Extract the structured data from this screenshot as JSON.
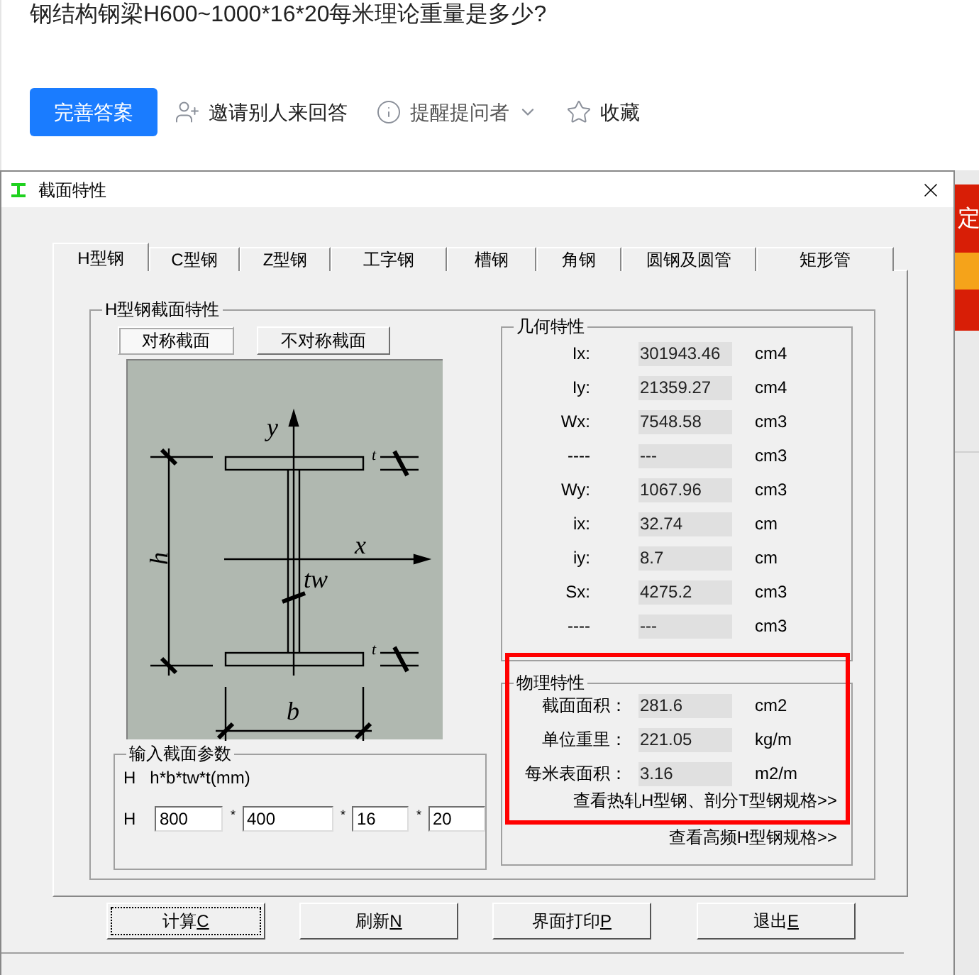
{
  "question": {
    "title": "钢结构钢梁H600~1000*16*20每米理论重量是多少?"
  },
  "actions": [
    {
      "kind": "primary",
      "label": "完善答案"
    },
    {
      "kind": "invite",
      "label": "邀请别人来回答"
    },
    {
      "kind": "remind",
      "label": "提醒提问者"
    },
    {
      "kind": "favorite",
      "label": "收藏"
    }
  ],
  "side_banner": {
    "text": "定"
  },
  "dialog": {
    "title": "截面特性",
    "tabs": [
      {
        "label": "H型钢",
        "selected": true
      },
      {
        "label": "C型钢",
        "selected": false
      },
      {
        "label": "Z型钢",
        "selected": false
      },
      {
        "label": "工字钢",
        "selected": false
      },
      {
        "label": "槽钢",
        "selected": false
      },
      {
        "label": "角钢",
        "selected": false
      },
      {
        "label": "圆钢及圆管",
        "selected": false
      },
      {
        "label": "矩形管",
        "selected": false
      }
    ],
    "section_group": "H型钢截面特性",
    "section_modes": [
      {
        "label": "对称截面",
        "selected": true
      },
      {
        "label": "不对称截面",
        "selected": false
      }
    ],
    "diagram_labels": {
      "y": "y",
      "x": "x",
      "h": "h",
      "tw": "tw",
      "t_top": "t",
      "t_bottom": "t",
      "b": "b"
    },
    "input_group": {
      "title": "输入截面参数",
      "prefix": "H",
      "format": "h*b*tw*t(mm)",
      "row_label": "H",
      "separator": "*",
      "values": [
        "800",
        "400",
        "16",
        "20"
      ]
    },
    "geometry": {
      "title": "几何特性",
      "rows": [
        {
          "label": "Ix:",
          "value": "301943.46",
          "unit": "cm4"
        },
        {
          "label": "Iy:",
          "value": "21359.27",
          "unit": "cm4"
        },
        {
          "label": "Wx:",
          "value": "7548.58",
          "unit": "cm3"
        },
        {
          "label": "----",
          "value": "---",
          "unit": "cm3"
        },
        {
          "label": "Wy:",
          "value": "1067.96",
          "unit": "cm3"
        },
        {
          "label": "ix:",
          "value": "32.74",
          "unit": "cm"
        },
        {
          "label": "iy:",
          "value": "8.7",
          "unit": "cm"
        },
        {
          "label": "Sx:",
          "value": "4275.2",
          "unit": "cm3"
        },
        {
          "label": "----",
          "value": "---",
          "unit": "cm3"
        }
      ]
    },
    "physical": {
      "title": "物理特性",
      "rows": [
        {
          "label": "截面面积：",
          "value": "281.6",
          "unit": "cm2"
        },
        {
          "label": "单位重里：",
          "value": "221.05",
          "unit": "kg/m"
        },
        {
          "label": "每米表面积：",
          "value": "3.16",
          "unit": "m2/m"
        }
      ],
      "links": [
        "查看热轧H型钢、剖分T型钢规格>>",
        "查看高频H型钢规格>>"
      ]
    },
    "buttons": [
      {
        "label": "计算",
        "hotkey": "C",
        "focused": true
      },
      {
        "label": "刷新",
        "hotkey": "N",
        "focused": false
      },
      {
        "label": "界面打印",
        "hotkey": "P",
        "focused": false
      },
      {
        "label": "退出",
        "hotkey": "E",
        "focused": false
      }
    ]
  }
}
